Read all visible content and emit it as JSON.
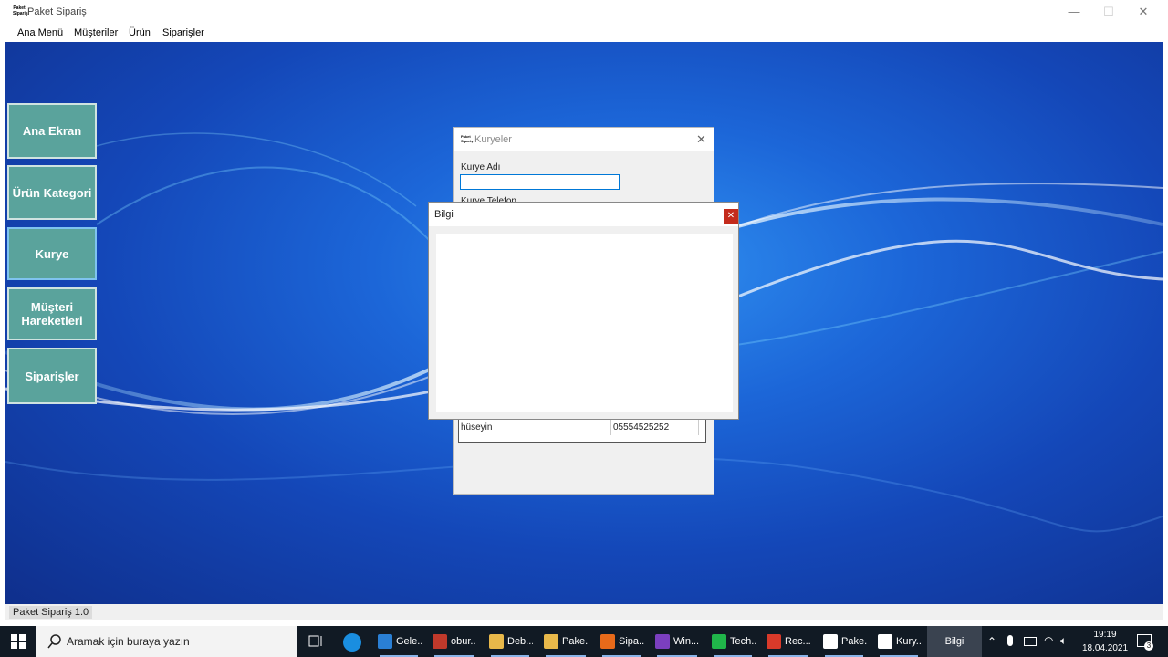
{
  "window": {
    "title": "Paket Sipariş",
    "icon_text": "Paket Sipariş",
    "controls": {
      "minimize": "—",
      "maximize": "☐",
      "close": "✕"
    }
  },
  "menu": [
    "Ana Menü",
    "Müşteriler",
    "Ürün",
    "Siparişler"
  ],
  "side_buttons": [
    {
      "label": "Ana Ekran",
      "active": false
    },
    {
      "label": "Ürün Kategori",
      "active": false
    },
    {
      "label": "Kurye",
      "active": true
    },
    {
      "label": "Müşteri Hareketleri",
      "active": false
    },
    {
      "label": "Siparişler",
      "active": false
    }
  ],
  "kuryeler": {
    "title": "Kuryeler",
    "close": "✕",
    "name_label": "Kurye Adı",
    "name_value": "",
    "phone_label": "Kurye Telefon",
    "rows": [
      {
        "name": "hüseyin",
        "phone": "05554525252"
      }
    ]
  },
  "bilgi": {
    "title": "Bilgi",
    "close": "✕"
  },
  "status": {
    "text": "Paket Sipariş 1.0"
  },
  "taskbar": {
    "search_placeholder": "Aramak için buraya yazın",
    "items": [
      {
        "label": "Gele...",
        "color": "#2a7fd4"
      },
      {
        "label": "obur...",
        "color": "#c0392b"
      },
      {
        "label": "Deb...",
        "color": "#e8b84a"
      },
      {
        "label": "Pake...",
        "color": "#e8b84a"
      },
      {
        "label": "Sipa...",
        "color": "#e86a1a"
      },
      {
        "label": "Win...",
        "color": "#7b3fbf"
      },
      {
        "label": "Tech...",
        "color": "#20b54a"
      },
      {
        "label": "Rec...",
        "color": "#d93a2a"
      },
      {
        "label": "Pake...",
        "color": "#ffffff"
      },
      {
        "label": "Kury...",
        "color": "#ffffff"
      },
      {
        "label": "Bilgi",
        "color": "#3a4a5a"
      }
    ],
    "clock_time": "19:19",
    "clock_date": "18.04.2021",
    "notification_count": "3"
  }
}
